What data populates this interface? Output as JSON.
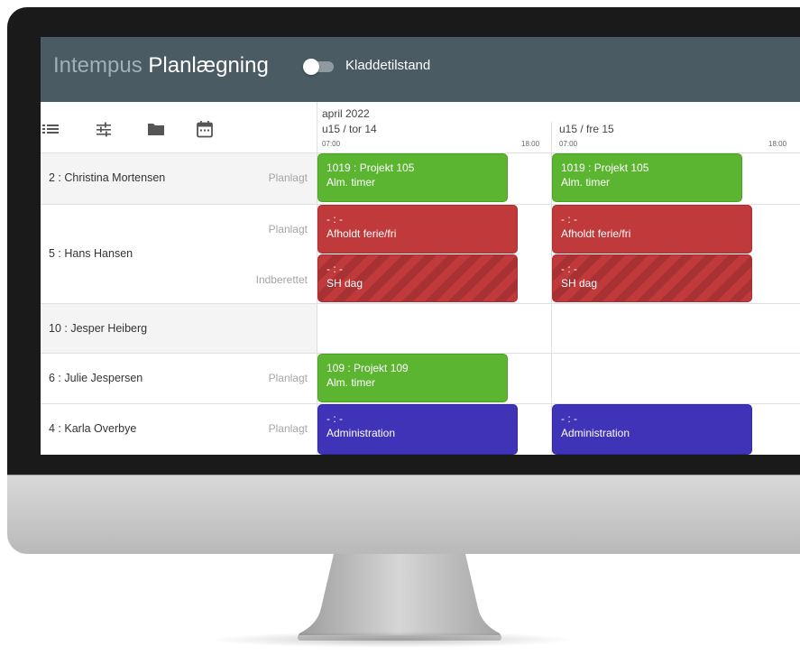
{
  "app": {
    "brand_light": "Intempus",
    "brand_strong": "Planlægning",
    "toggle_label": "Kladdetilstand",
    "toggle_on": false
  },
  "toolbar": {
    "icons": [
      "list-icon",
      "sliders-icon",
      "folder-icon",
      "calendar-icon"
    ]
  },
  "timeline": {
    "month": "april 2022",
    "days": [
      {
        "label": "u15 / tor 14",
        "start": "07:00",
        "end": "18:00"
      },
      {
        "label": "u15 / fre 15",
        "start": "07:00",
        "end": "18:00"
      }
    ]
  },
  "rows": [
    {
      "name": "2 : Christina Mortensen",
      "statuses": [
        "Planlagt"
      ],
      "events": [
        {
          "day": 0,
          "line1": "1019 : Projekt 105",
          "line2": "Alm. timer",
          "color": "#5cb531"
        },
        {
          "day": 1,
          "line1": "1019 : Projekt 105",
          "line2": "Alm. timer",
          "color": "#5cb531"
        }
      ]
    },
    {
      "name": "5 : Hans Hansen",
      "statuses": [
        "Planlagt",
        "Indberettet"
      ],
      "events": [
        {
          "day": 0,
          "line1": "- : -",
          "line2": "Afholdt ferie/fri",
          "color": "#c0393b"
        },
        {
          "day": 1,
          "line1": "- : -",
          "line2": "Afholdt ferie/fri",
          "color": "#c0393b"
        },
        {
          "day": 0,
          "line1": "- : -",
          "line2": "SH dag",
          "color": "#c0393b",
          "striped": true
        },
        {
          "day": 1,
          "line1": "- : -",
          "line2": "SH dag",
          "color": "#c0393b",
          "striped": true
        }
      ]
    },
    {
      "name": "10 : Jesper Heiberg",
      "statuses": [],
      "events": []
    },
    {
      "name": "6 : Julie Jespersen",
      "statuses": [
        "Planlagt"
      ],
      "events": [
        {
          "day": 0,
          "line1": "109 : Projekt 109",
          "line2": "Alm. timer",
          "color": "#5cb531"
        }
      ]
    },
    {
      "name": "4 : Karla Overbye",
      "statuses": [
        "Planlagt"
      ],
      "events": [
        {
          "day": 0,
          "line1": "- : -",
          "line2": "Administration",
          "color": "#3f33b8"
        },
        {
          "day": 1,
          "line1": "- : -",
          "line2": "Administration",
          "color": "#3f33b8"
        }
      ]
    }
  ]
}
